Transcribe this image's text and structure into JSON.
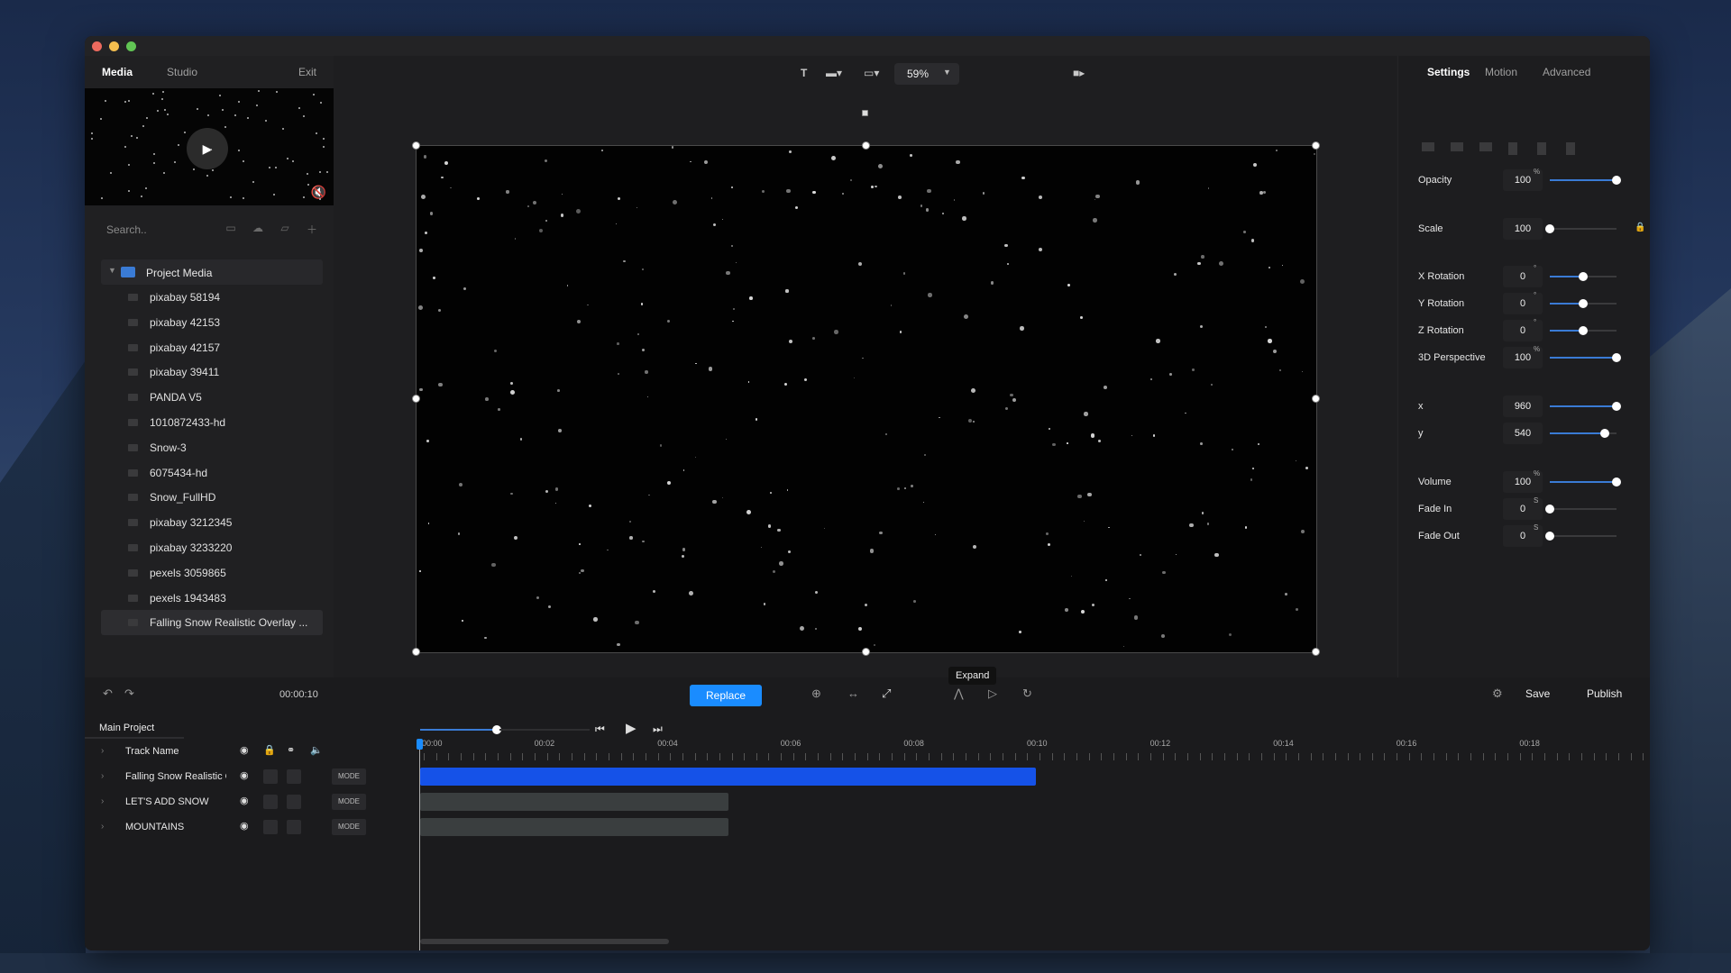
{
  "left_tabs": {
    "media": "Media",
    "studio": "Studio",
    "exit": "Exit"
  },
  "search": {
    "placeholder": "Search.."
  },
  "project_media": {
    "folder": "Project Media",
    "items": [
      "pixabay 58194",
      "pixabay 42153",
      "pixabay 42157",
      "pixabay 39411",
      "PANDA V5",
      "1010872433-hd",
      "Snow-3",
      "6075434-hd",
      "Snow_FullHD",
      "pixabay 3212345",
      "pixabay 3233220",
      "pexels 3059865",
      "pexels 1943483",
      "Falling Snow Realistic Overlay ..."
    ]
  },
  "toolbar": {
    "zoom": "59%"
  },
  "tooltip": "Expand",
  "right_tabs": {
    "settings": "Settings",
    "motion": "Motion",
    "advanced": "Advanced"
  },
  "properties": [
    {
      "name": "Opacity",
      "value": "100",
      "unit": "%",
      "level": 1.0
    },
    {
      "name": "Scale",
      "value": "100",
      "unit": "",
      "level": 0.0
    },
    {
      "name": "X Rotation",
      "value": "0",
      "unit": "°",
      "level": 0.5
    },
    {
      "name": "Y Rotation",
      "value": "0",
      "unit": "°",
      "level": 0.5
    },
    {
      "name": "Z Rotation",
      "value": "0",
      "unit": "°",
      "level": 0.5
    },
    {
      "name": "3D Perspective",
      "value": "100",
      "unit": "%",
      "level": 1.0
    },
    {
      "name": "x",
      "value": "960",
      "unit": "",
      "level": 1.0
    },
    {
      "name": "y",
      "value": "540",
      "unit": "",
      "level": 0.82
    },
    {
      "name": "Volume",
      "value": "100",
      "unit": "%",
      "level": 1.0
    },
    {
      "name": "Fade In",
      "value": "0",
      "unit": "S",
      "level": 0.0
    },
    {
      "name": "Fade Out",
      "value": "0",
      "unit": "S",
      "level": 0.0
    }
  ],
  "bottom": {
    "time": "00:00:10",
    "replace": "Replace",
    "save": "Save",
    "publish": "Publish"
  },
  "timeline": {
    "tab": "Main Project",
    "header": "Track Name",
    "ruler": [
      "00:00",
      "00:02",
      "00:04",
      "00:06",
      "00:08",
      "00:10",
      "00:12",
      "00:14",
      "00:16",
      "00:18"
    ],
    "tracks": [
      {
        "name": "Falling Snow Realistic Overlay",
        "mode": "MODE",
        "clip_end_s": 10.0,
        "color": "#1552e8"
      },
      {
        "name": "LET'S ADD SNOW",
        "mode": "MODE",
        "clip_end_s": 5.0,
        "color": "#3a3e3f"
      },
      {
        "name": "MOUNTAINS",
        "mode": "MODE",
        "clip_end_s": 5.0,
        "color": "#3a3e3f"
      }
    ]
  },
  "colors": {
    "accent": "#1a8cff",
    "clip_selected": "#1552e8"
  }
}
